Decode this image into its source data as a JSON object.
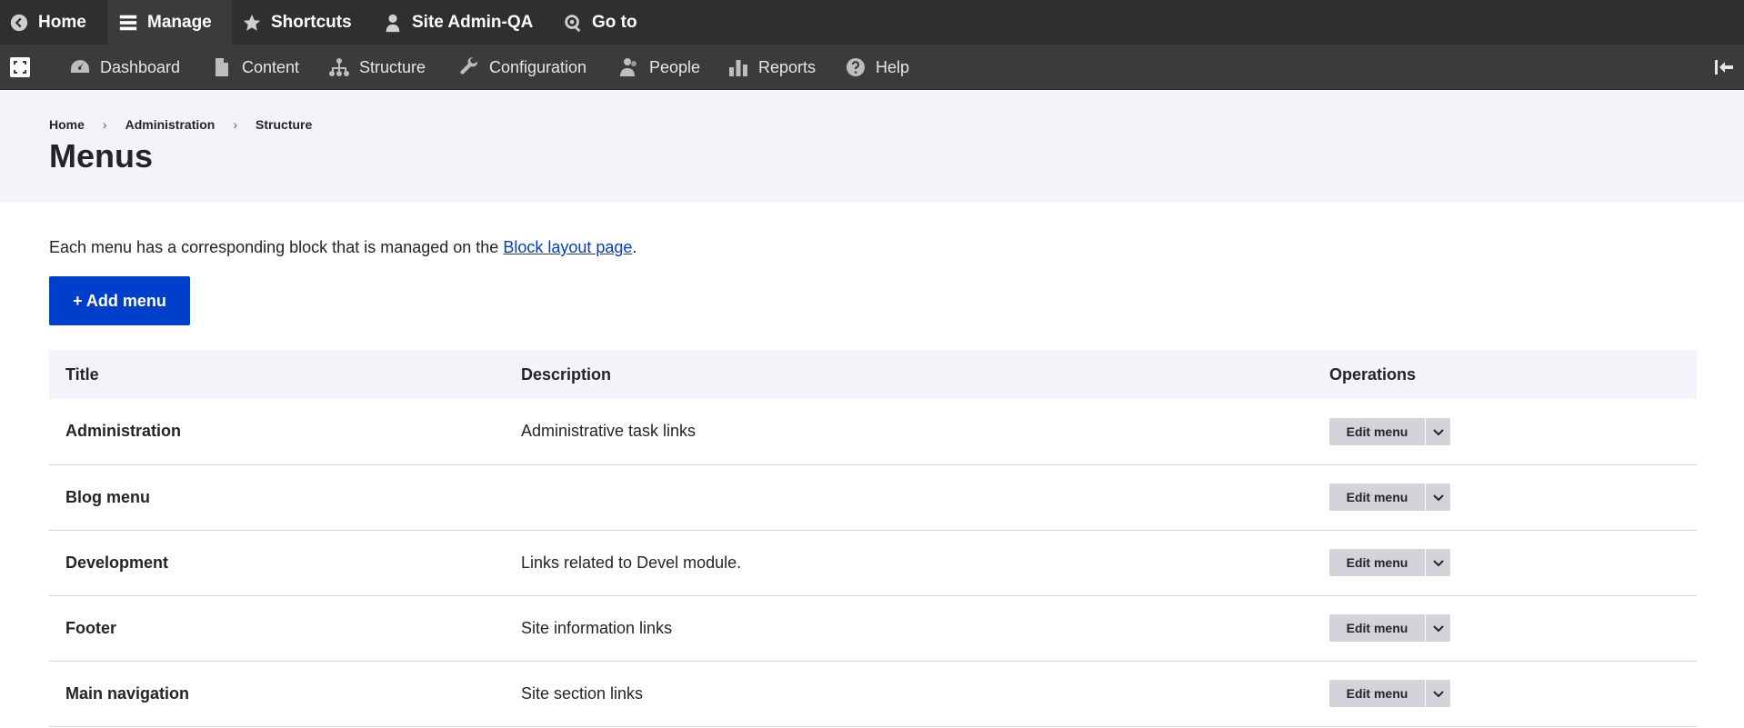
{
  "toolbar": {
    "home": "Home",
    "manage": "Manage",
    "shortcuts": "Shortcuts",
    "user": "Site Admin-QA",
    "goto": "Go to"
  },
  "tray": {
    "items": [
      {
        "label": "Dashboard",
        "icon": "dashboard-icon"
      },
      {
        "label": "Content",
        "icon": "content-icon"
      },
      {
        "label": "Structure",
        "icon": "structure-icon"
      },
      {
        "label": "Configuration",
        "icon": "wrench-icon"
      },
      {
        "label": "People",
        "icon": "people-icon"
      },
      {
        "label": "Reports",
        "icon": "reports-icon"
      },
      {
        "label": "Help",
        "icon": "help-icon"
      }
    ]
  },
  "breadcrumb": [
    "Home",
    "Administration",
    "Structure"
  ],
  "page": {
    "title": "Menus",
    "intro_text": "Each menu has a corresponding block that is managed on the ",
    "intro_link": "Block layout page",
    "intro_end": ".",
    "add_button": "+ Add menu"
  },
  "table": {
    "headers": [
      "Title",
      "Description",
      "Operations"
    ],
    "edit_label": "Edit menu",
    "rows": [
      {
        "title": "Administration",
        "description": "Administrative task links"
      },
      {
        "title": "Blog menu",
        "description": ""
      },
      {
        "title": "Development",
        "description": "Links related to Devel module."
      },
      {
        "title": "Footer",
        "description": "Site information links"
      },
      {
        "title": "Main navigation",
        "description": "Site section links"
      }
    ]
  },
  "colors": {
    "toolbar": "#2f2f2f",
    "tray": "#3b3b3b",
    "header_bg": "#f3f4f9",
    "primary": "#003ecc",
    "button_gray": "#d3d4d9"
  }
}
